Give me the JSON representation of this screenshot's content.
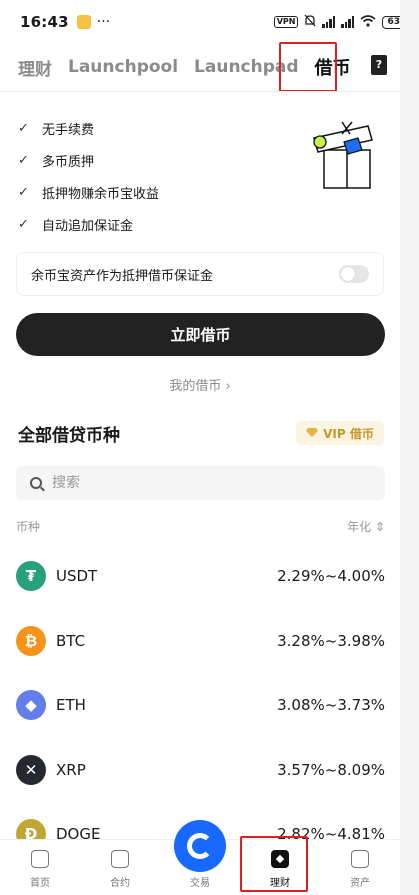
{
  "status_bar": {
    "time": "16:43",
    "dots": "···",
    "vpn": "VPN",
    "battery": "63"
  },
  "tabs": [
    {
      "label": "理财"
    },
    {
      "label": "Launchpool"
    },
    {
      "label": "Launchpad"
    },
    {
      "label": "借币"
    }
  ],
  "features": [
    "无手续费",
    "多币质押",
    "抵押物赚余币宝收益",
    "自动追加保证金"
  ],
  "toggle_card": {
    "label": "余币宝资产作为抵押借币保证金",
    "enabled": false
  },
  "primary_button": "立即借币",
  "my_loans": "我的借币 ›",
  "section": {
    "title": "全部借贷币种",
    "vip_badge": "VIP 借币"
  },
  "search": {
    "placeholder": "搜索"
  },
  "columns": {
    "left": "币种",
    "right": "年化 ⇕"
  },
  "coins": [
    {
      "name": "USDT",
      "rate": "2.29%~4.00%",
      "icon": "₮",
      "color": "#26a17b"
    },
    {
      "name": "BTC",
      "rate": "3.28%~3.98%",
      "icon": "₿",
      "color": "#f7931a"
    },
    {
      "name": "ETH",
      "rate": "3.08%~3.73%",
      "icon": "◆",
      "color": "#627eea"
    },
    {
      "name": "XRP",
      "rate": "3.57%~8.09%",
      "icon": "✕",
      "color": "#23292f"
    },
    {
      "name": "DOGE",
      "rate": "2.82%~4.81%",
      "icon": "Ð",
      "color": "#c2a633"
    }
  ],
  "bottom_nav": [
    {
      "label": "首页",
      "icon": "home-icon"
    },
    {
      "label": "合约",
      "icon": "chart-icon"
    },
    {
      "label": "交易",
      "icon": "trade-icon"
    },
    {
      "label": "理财",
      "icon": "finance-icon"
    },
    {
      "label": "资产",
      "icon": "wallet-icon"
    }
  ]
}
